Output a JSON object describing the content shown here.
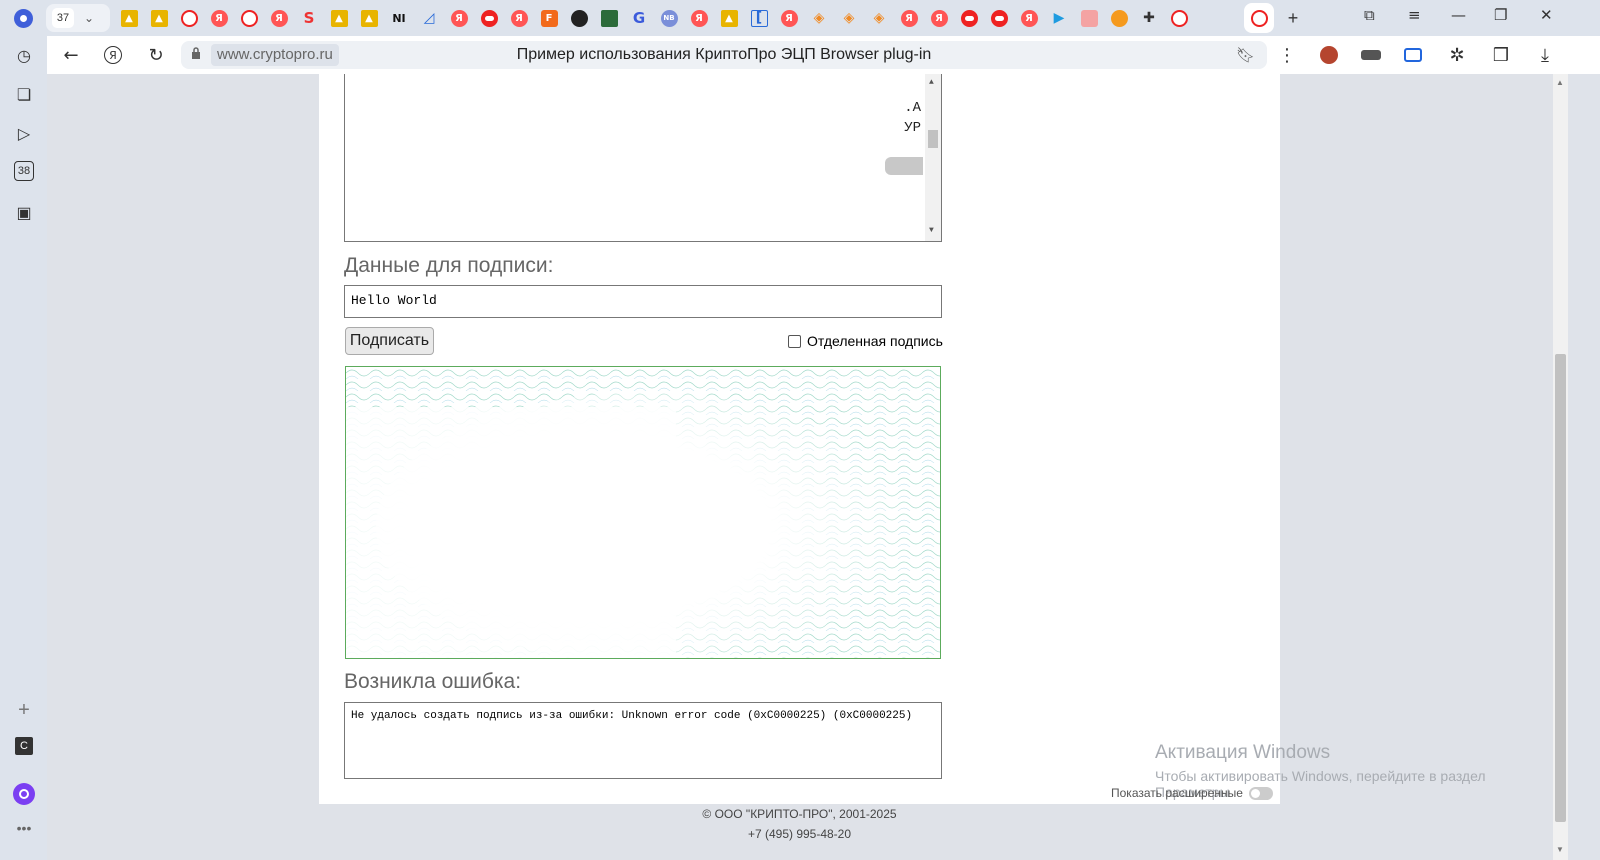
{
  "browser": {
    "tab_count": "37",
    "url": "www.cryptopro.ru",
    "page_title": "Пример использования КриптоПро ЭЦП Browser plug-in"
  },
  "page": {
    "cert_list_lines": [
      ".А",
      "УР"
    ],
    "data_label": "Данные для подписи:",
    "data_value": "Hello World",
    "sign_button": "Подписать",
    "detached_label": "Отделенная подпись",
    "error_label": "Возникла ошибка:",
    "error_text": "Не удалось создать подпись из-за ошибки: Unknown error code (0xC0000225) (0xC0000225)",
    "footer_copyright": "© ООО \"КРИПТО-ПРО\", 2001-2025",
    "footer_phone": "+7 (495) 995-48-20",
    "toggle_label": "Показать расширенные"
  },
  "watermark": {
    "title": "Активация Windows",
    "subtitle": "Чтобы активировать Windows, перейдите в раздел",
    "subtitle2": "Параметры"
  },
  "colors": {
    "accent": "#1a73e8",
    "sign_box_border": "#5cab5c"
  }
}
